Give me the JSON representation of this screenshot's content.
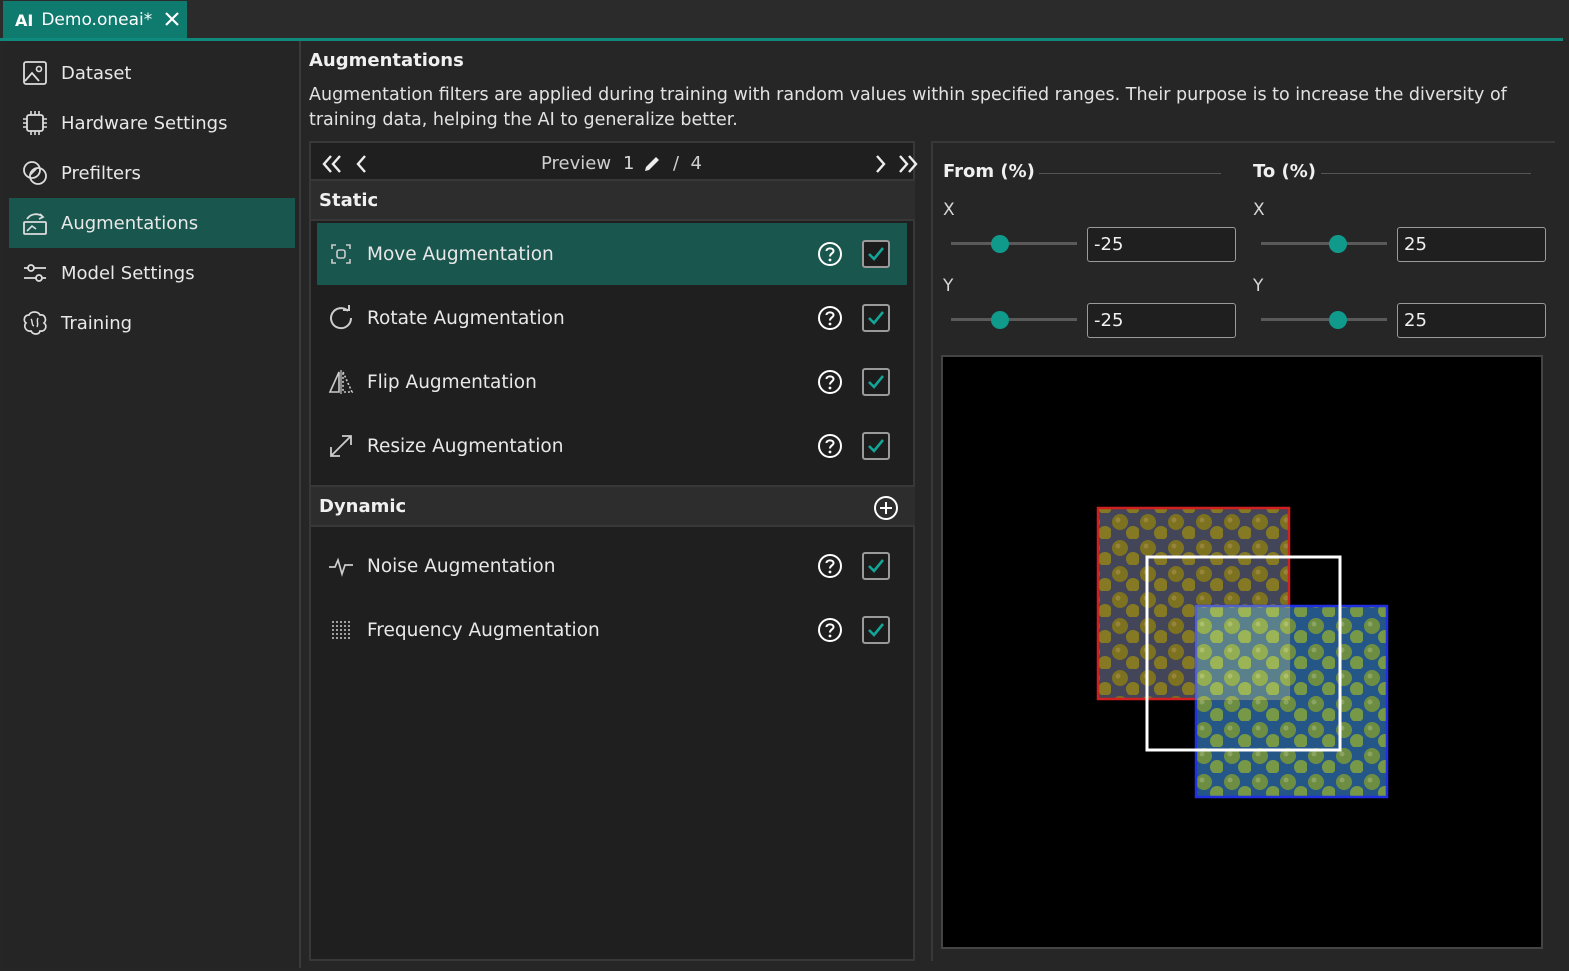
{
  "tab": {
    "ai_badge": "AI",
    "title": "Demo.oneai*"
  },
  "sidebar": {
    "items": [
      {
        "label": "Dataset",
        "icon": "image-icon",
        "active": false
      },
      {
        "label": "Hardware Settings",
        "icon": "chip-icon",
        "active": false
      },
      {
        "label": "Prefilters",
        "icon": "filter-icon",
        "active": false
      },
      {
        "label": "Augmentations",
        "icon": "augment-icon",
        "active": true
      },
      {
        "label": "Model Settings",
        "icon": "sliders-icon",
        "active": false
      },
      {
        "label": "Training",
        "icon": "brain-icon",
        "active": false
      }
    ]
  },
  "main": {
    "title": "Augmentations",
    "description": "Augmentation filters are applied during training with random values within specified ranges. Their purpose is to increase the diversity of training data, helping the AI to generalize better."
  },
  "pager": {
    "label": "Preview",
    "current": "1",
    "separator": "/",
    "total": "4"
  },
  "static_section": {
    "title": "Static",
    "items": [
      {
        "label": "Move Augmentation",
        "icon": "move-icon",
        "checked": true,
        "active": true
      },
      {
        "label": "Rotate Augmentation",
        "icon": "rotate-icon",
        "checked": true,
        "active": false
      },
      {
        "label": "Flip Augmentation",
        "icon": "flip-icon",
        "checked": true,
        "active": false
      },
      {
        "label": "Resize Augmentation",
        "icon": "resize-icon",
        "checked": true,
        "active": false
      }
    ]
  },
  "dynamic_section": {
    "title": "Dynamic",
    "items": [
      {
        "label": "Noise Augmentation",
        "icon": "noise-icon",
        "checked": true
      },
      {
        "label": "Frequency Augmentation",
        "icon": "frequency-icon",
        "checked": true
      }
    ]
  },
  "settings": {
    "from_label": "From (%)",
    "to_label": "To (%)",
    "x_label": "X",
    "y_label": "Y",
    "from_x": "-25",
    "from_y": "-25",
    "to_x": "25",
    "to_y": "25"
  },
  "colors": {
    "accent": "#109a8b",
    "active_bg": "#19564e"
  }
}
